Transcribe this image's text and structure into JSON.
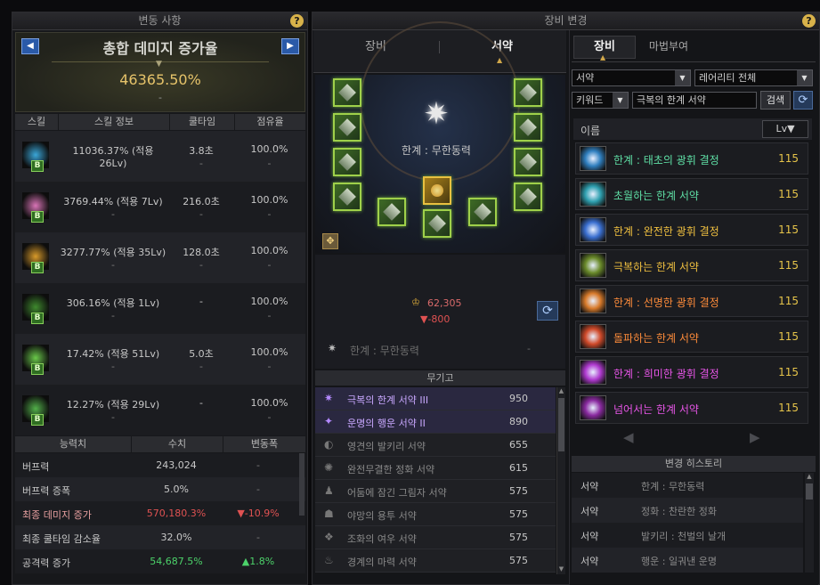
{
  "left_panel": {
    "title": "변동 사항",
    "banner_title": "총합 데미지 증가율",
    "banner_value": "46365.50%",
    "banner_sub": "-",
    "skill_headers": [
      "스킬",
      "스킬 정보",
      "쿨타임",
      "점유율"
    ],
    "skills": [
      {
        "info": "11036.37% (적용 26Lv)",
        "sub": "-",
        "cool": "3.8초",
        "cool_sub": "-",
        "share": "100.0%",
        "share_sub": "-",
        "color": "#3aa6d8",
        "badge": "B"
      },
      {
        "info": "3769.44% (적용 7Lv)",
        "sub": "-",
        "cool": "216.0초",
        "cool_sub": "-",
        "share": "100.0%",
        "share_sub": "-",
        "color": "#d874b6",
        "badge": "B"
      },
      {
        "info": "3277.77% (적용 35Lv)",
        "sub": "-",
        "cool": "128.0초",
        "cool_sub": "-",
        "share": "100.0%",
        "share_sub": "-",
        "color": "#d89a2a",
        "badge": "B"
      },
      {
        "info": "306.16% (적용 1Lv)",
        "sub": "-",
        "cool": "-",
        "cool_sub": "",
        "share": "100.0%",
        "share_sub": "-",
        "color": "#3f8a2e",
        "badge": "B"
      },
      {
        "info": "17.42% (적용 51Lv)",
        "sub": "-",
        "cool": "5.0초",
        "cool_sub": "-",
        "share": "100.0%",
        "share_sub": "-",
        "color": "#6ac94a",
        "badge": "B"
      },
      {
        "info": "12.27% (적용 29Lv)",
        "sub": "-",
        "cool": "-",
        "cool_sub": "",
        "share": "100.0%",
        "share_sub": "-",
        "color": "#52b04a",
        "badge": "B"
      }
    ],
    "stat_headers": [
      "능력치",
      "수치",
      "변동폭"
    ],
    "stats": [
      {
        "name": "버프력",
        "value": "243,024",
        "change": "-",
        "vcolor": "#c8c8c8",
        "ccolor": "#7d7d7d",
        "ncolor": "#c8c8c8"
      },
      {
        "name": "버프력 증폭",
        "value": "5.0%",
        "change": "-",
        "vcolor": "#c8c8c8",
        "ccolor": "#7d7d7d",
        "ncolor": "#c8c8c8"
      },
      {
        "name": "최종 데미지 증가",
        "value": "570,180.3%",
        "change": "▼-10.9%",
        "vcolor": "#e05252",
        "ccolor": "#e05252",
        "ncolor": "#e8a0a0"
      },
      {
        "name": "최종 쿨타임 감소율",
        "value": "32.0%",
        "change": "-",
        "vcolor": "#c8c8c8",
        "ccolor": "#7d7d7d",
        "ncolor": "#c8c8c8"
      },
      {
        "name": "공격력 증가",
        "value": "54,687.5%",
        "change": "▲1.8%",
        "vcolor": "#4cd26a",
        "ccolor": "#4cd26a",
        "ncolor": "#c8c8c8"
      }
    ]
  },
  "middle_panel": {
    "title": "장비 변경",
    "tabs": [
      "장비",
      "서약"
    ],
    "active_tab": "서약",
    "center_label": "한계 : 무한동력",
    "power_value": "62,305",
    "power_change": "▼-800",
    "selected_item": "한계 : 무한동력",
    "selected_item_level": "-",
    "inventory_title": "무기고",
    "inventory": [
      {
        "name": "극복의 한계 서약 III",
        "value": "950",
        "color": "#c9a8ff",
        "active": true,
        "icon": "✷"
      },
      {
        "name": "운명의 행운 서약 II",
        "value": "890",
        "color": "#c9a8ff",
        "active": true,
        "icon": "✦"
      },
      {
        "name": "영견의 발키리 서약",
        "value": "655",
        "color": "#8a8a8a",
        "active": false,
        "icon": "◐"
      },
      {
        "name": "완전무결한 정화 서약",
        "value": "615",
        "color": "#8a8a8a",
        "active": false,
        "icon": "✺"
      },
      {
        "name": "어둠에 잠긴 그림자 서약",
        "value": "575",
        "color": "#8a8a8a",
        "active": false,
        "icon": "♟"
      },
      {
        "name": "야망의 용투 서약",
        "value": "575",
        "color": "#8a8a8a",
        "active": false,
        "icon": "☗"
      },
      {
        "name": "조화의 여우 서약",
        "value": "575",
        "color": "#8a8a8a",
        "active": false,
        "icon": "❖"
      },
      {
        "name": "경계의 마력 서약",
        "value": "575",
        "color": "#8a8a8a",
        "active": false,
        "icon": "♨"
      }
    ]
  },
  "right_panel": {
    "tabs": [
      "장비",
      "마법부여"
    ],
    "filter1": "서약",
    "filter2": "레어리티 전체",
    "keyword_label": "키워드",
    "search_value": "극복의 한계 서약",
    "search_button": "검색",
    "col_name": "이름",
    "col_lv": "Lv▼",
    "items": [
      {
        "name": "한계 : 태초의 광휘 결정",
        "lv": "115",
        "color": "#5fe0a6",
        "icon": "#2f7fbf"
      },
      {
        "name": "초월하는 한계 서약",
        "lv": "115",
        "color": "#5fe0a6",
        "icon": "#2fa0b0"
      },
      {
        "name": "한계 : 완전한 광휘 결정",
        "lv": "115",
        "color": "#f0c040",
        "icon": "#3a6fd0"
      },
      {
        "name": "극복하는 한계 서약",
        "lv": "115",
        "color": "#f0c040",
        "icon": "#6a8a2a"
      },
      {
        "name": "한계 : 선명한 광휘 결정",
        "lv": "115",
        "color": "#ff8c3a",
        "icon": "#d87a2a"
      },
      {
        "name": "돌파하는 한계 서약",
        "lv": "115",
        "color": "#ff8c3a",
        "icon": "#d04a2a"
      },
      {
        "name": "한계 : 희미한 광휘 결정",
        "lv": "115",
        "color": "#e855e8",
        "icon": "#b03ad0"
      },
      {
        "name": "넘어서는 한계 서약",
        "lv": "115",
        "color": "#e855e8",
        "icon": "#8a2aa0"
      }
    ],
    "history_title": "변경 히스토리",
    "history": [
      {
        "type": "서약",
        "name": "한계 : 무한동력"
      },
      {
        "type": "서약",
        "name": "정화 : 찬란한 정화"
      },
      {
        "type": "서약",
        "name": "발키리 : 천벌의 날개"
      },
      {
        "type": "서약",
        "name": "행운 : 일궈낸 운명"
      }
    ]
  }
}
